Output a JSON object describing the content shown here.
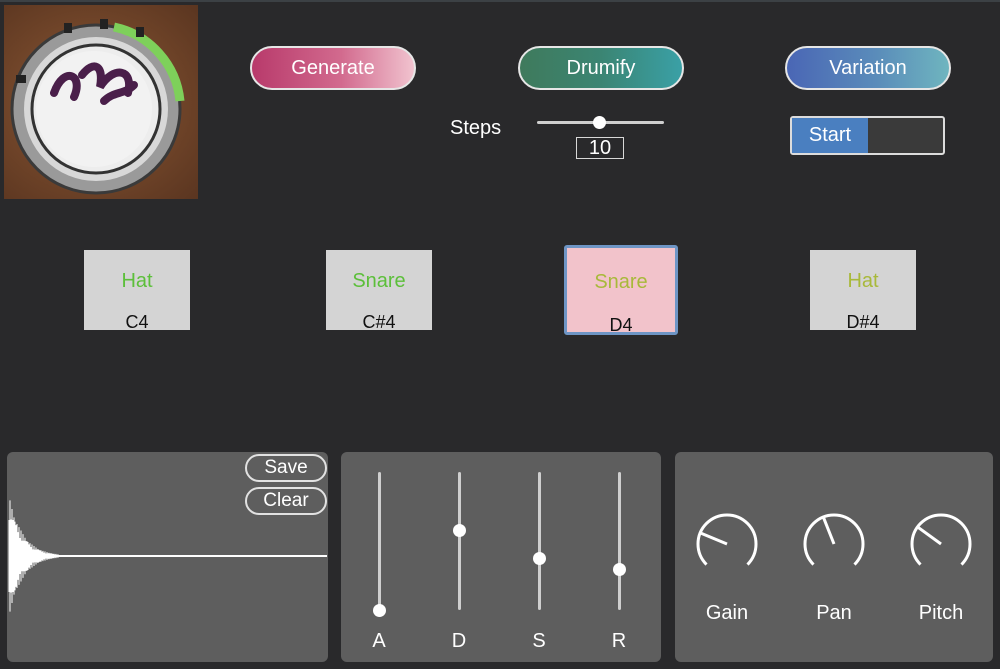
{
  "logo": {
    "text": "CRASSHHFY",
    "small_text": "SD"
  },
  "buttons": {
    "generate": "Generate",
    "drumify": "Drumify",
    "variation": "Variation"
  },
  "steps": {
    "label": "Steps",
    "value": "10",
    "level_fraction": 0.5
  },
  "toggle": {
    "label": "Start",
    "state": "on"
  },
  "pads": [
    {
      "name": "Hat",
      "note": "C4",
      "name_color": "#5cbf3a",
      "selected": false
    },
    {
      "name": "Snare",
      "note": "C#4",
      "name_color": "#5cbf3a",
      "selected": false
    },
    {
      "name": "Snare",
      "note": "D4",
      "name_color": "#a8b93a",
      "selected": true
    },
    {
      "name": "Hat",
      "note": "D#4",
      "name_color": "#a8b93a",
      "selected": false
    }
  ],
  "waveform": {
    "save_label": "Save",
    "clear_label": "Clear"
  },
  "adsr": [
    {
      "label": "A",
      "level_fraction": 0.0
    },
    {
      "label": "D",
      "level_fraction": 0.58
    },
    {
      "label": "S",
      "level_fraction": 0.38
    },
    {
      "label": "R",
      "level_fraction": 0.3
    }
  ],
  "knobs": [
    {
      "label": "Gain",
      "value_fraction": 0.25
    },
    {
      "label": "Pan",
      "value_fraction": 0.42
    },
    {
      "label": "Pitch",
      "value_fraction": 0.3
    }
  ],
  "colors": {
    "background": "#29292b",
    "panel": "#5e5e5e",
    "pad": "#d4d4d4",
    "selected_pad": "#f2c3cb",
    "selected_border": "#6e95c5",
    "toggle_on": "#4a7fc0"
  }
}
